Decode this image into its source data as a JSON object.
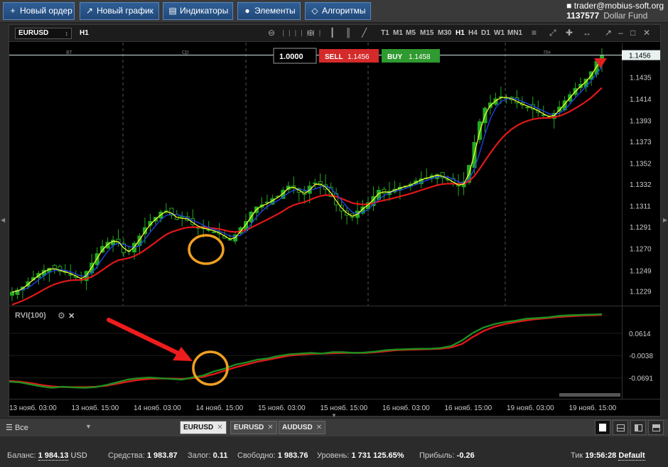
{
  "toolbar": {
    "new_order": "Новый ордер",
    "new_chart": "Новый график",
    "indicators": "Индикаторы",
    "elements": "Элементы",
    "algorithms": "Алгоритмы"
  },
  "account": {
    "user": "trader@mobius-soft.org",
    "number": "1137577",
    "fund": "Dollar Fund"
  },
  "chart": {
    "symbol": "EURUSD",
    "timeframe": "H1",
    "timeframes": [
      "T1",
      "M1",
      "M5",
      "M15",
      "M30",
      "H1",
      "H4",
      "D1",
      "W1",
      "MN1"
    ],
    "active_timeframe": "H1",
    "quantity": "1.0000",
    "sell_label": "SELL",
    "sell_price": "1.1456",
    "buy_label": "BUY",
    "buy_price": "1.1458",
    "day_labels": [
      "вт",
      "ср",
      "пн"
    ],
    "last_price_label": "1.1456",
    "indicator_label": "RVI(100)",
    "colors": {
      "bull_candle": "#22aa22",
      "bear_candle": "#22aa22",
      "fast_ma": "#ffff33",
      "mid_ma": "#2040e0",
      "slow_ma": "#e01818",
      "rvi_main": "#1f8f1f",
      "rvi_signal": "#e01818",
      "annotation_circle": "#f0a020",
      "annotation_arrow": "#ee1c1c"
    }
  },
  "chart_data": {
    "type": "candlestick",
    "symbol": "EURUSD",
    "price_ticks": [
      "1.1435",
      "1.1414",
      "1.1393",
      "1.1373",
      "1.1352",
      "1.1332",
      "1.1311",
      "1.1291",
      "1.1270",
      "1.1249",
      "1.1229"
    ],
    "price_range": [
      1.1215,
      1.1468
    ],
    "time_labels": [
      "13 нояб. 03:00",
      "13 нояб. 15:00",
      "14 нояб. 03:00",
      "14 нояб. 15:00",
      "15 нояб. 03:00",
      "15 нояб. 15:00",
      "16 нояб. 03:00",
      "16 нояб. 15:00",
      "19 нояб. 03:00",
      "19 нояб. 15:00"
    ],
    "close_series": [
      1.1228,
      1.123,
      1.1233,
      1.1238,
      1.1242,
      1.1246,
      1.1249,
      1.1251,
      1.125,
      1.1248,
      1.1247,
      1.1245,
      1.1242,
      1.124,
      1.1248,
      1.1256,
      1.1265,
      1.1272,
      1.1276,
      1.1278,
      1.1275,
      1.1266,
      1.1268,
      1.1275,
      1.1282,
      1.129,
      1.1296,
      1.13,
      1.1305,
      1.1306,
      1.1302,
      1.1298,
      1.13,
      1.1297,
      1.1293,
      1.129,
      1.1289,
      1.1288,
      1.1286,
      1.1284,
      1.128,
      1.1278,
      1.1283,
      1.129,
      1.1296,
      1.1305,
      1.131,
      1.1312,
      1.1314,
      1.1318,
      1.132,
      1.1326,
      1.133,
      1.1328,
      1.1324,
      1.1322,
      1.133,
      1.1333,
      1.1331,
      1.1327,
      1.132,
      1.1312,
      1.1306,
      1.1302,
      1.13,
      1.1306,
      1.131,
      1.1314,
      1.132,
      1.1326,
      1.1323,
      1.1325,
      1.1327,
      1.1329,
      1.133,
      1.1332,
      1.1335,
      1.1337,
      1.1338,
      1.134,
      1.1341,
      1.1338,
      1.1336,
      1.1332,
      1.133,
      1.1334,
      1.135,
      1.1372,
      1.1392,
      1.1405,
      1.141,
      1.1414,
      1.1416,
      1.1415,
      1.1413,
      1.141,
      1.1408,
      1.1406,
      1.1404,
      1.1401,
      1.1398,
      1.1396,
      1.14,
      1.1406,
      1.1412,
      1.1418,
      1.1424,
      1.1428,
      1.1433,
      1.144,
      1.145,
      1.1456
    ],
    "rvi_ticks": [
      "0.0614",
      "-0.0038",
      "-0.0691"
    ],
    "rvi_range": [
      -0.13,
      0.14
    ],
    "rvi_main": [
      -0.08,
      -0.082,
      -0.088,
      -0.094,
      -0.098,
      -0.095,
      -0.097,
      -0.098,
      -0.096,
      -0.09,
      -0.082,
      -0.074,
      -0.07,
      -0.068,
      -0.07,
      -0.072,
      -0.074,
      -0.068,
      -0.062,
      -0.05,
      -0.042,
      -0.03,
      -0.024,
      -0.016,
      -0.012,
      -0.005,
      0.0,
      0.002,
      0.004,
      0.002,
      0.006,
      0.006,
      0.004,
      0.005,
      0.008,
      0.012,
      0.014,
      0.015,
      0.016,
      0.016,
      0.018,
      0.024,
      0.04,
      0.062,
      0.078,
      0.088,
      0.094,
      0.098,
      0.104,
      0.106,
      0.108,
      0.112,
      0.114,
      0.115,
      0.116,
      0.117
    ],
    "rvi_signal": [
      -0.078,
      -0.08,
      -0.084,
      -0.09,
      -0.094,
      -0.096,
      -0.096,
      -0.096,
      -0.095,
      -0.092,
      -0.086,
      -0.08,
      -0.075,
      -0.072,
      -0.071,
      -0.071,
      -0.072,
      -0.07,
      -0.066,
      -0.058,
      -0.048,
      -0.038,
      -0.03,
      -0.022,
      -0.016,
      -0.01,
      -0.004,
      -0.001,
      0.001,
      0.002,
      0.003,
      0.004,
      0.004,
      0.004,
      0.006,
      0.009,
      0.012,
      0.013,
      0.014,
      0.015,
      0.016,
      0.02,
      0.03,
      0.05,
      0.068,
      0.08,
      0.088,
      0.094,
      0.099,
      0.103,
      0.106,
      0.109,
      0.111,
      0.113,
      0.114,
      0.115
    ]
  },
  "tabs": {
    "filter": "Все",
    "items": [
      {
        "label": "EURUSD",
        "active": true
      },
      {
        "label": "EURUSD",
        "active": false
      },
      {
        "label": "AUDUSD",
        "active": false
      }
    ]
  },
  "status": {
    "balance_label": "Баланс:",
    "balance_value": "1 984.13",
    "currency": "USD",
    "equity_label": "Средства:",
    "equity_value": "1 983.87",
    "margin_label": "Залог:",
    "margin_value": "0.11",
    "free_label": "Свободно:",
    "free_value": "1 983.76",
    "level_label": "Уровень:",
    "level_value": "1 731 125.65%",
    "profit_label": "Прибыль:",
    "profit_value": "-0.26",
    "tick_label": "Тик",
    "time": "19:56:28",
    "tz": "Default"
  }
}
